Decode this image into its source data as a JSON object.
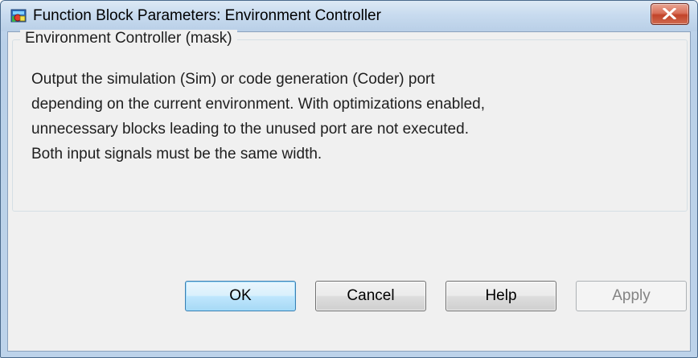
{
  "window": {
    "title": "Function Block Parameters: Environment Controller"
  },
  "group": {
    "legend": "Environment Controller (mask)",
    "description_lines": [
      "Output the simulation (Sim) or code generation (Coder) port",
      "depending on the current environment.  With optimizations enabled,",
      "unnecessary blocks leading to the unused port are not executed.",
      "Both input signals must be the same width."
    ]
  },
  "buttons": {
    "ok": "OK",
    "cancel": "Cancel",
    "help": "Help",
    "apply": "Apply"
  },
  "icons": {
    "app": "simulink-block-icon",
    "close": "close-icon"
  },
  "colors": {
    "close_button": "#c2442a",
    "default_button_border": "#3c7fb1",
    "dialog_background": "#f0f0f0"
  }
}
